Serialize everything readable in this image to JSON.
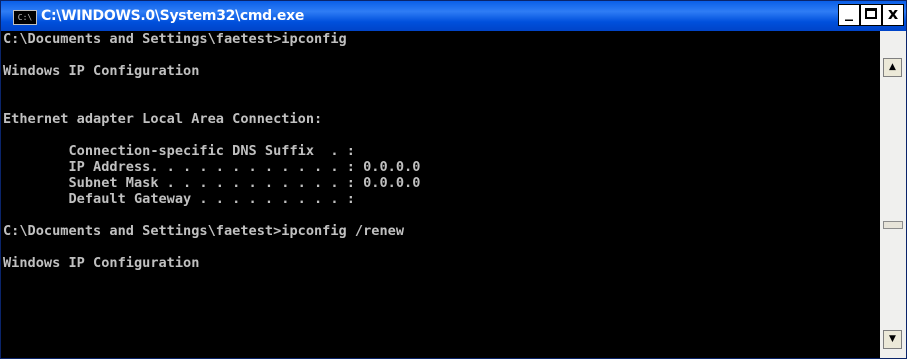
{
  "window": {
    "title": "C:\\WINDOWS.0\\System32\\cmd.exe",
    "icon_label": "C:\\",
    "controls": {
      "minimize": "_",
      "maximize": "",
      "close": "x"
    }
  },
  "console": {
    "lines": [
      "C:\\Documents and Settings\\faetest>ipconfig",
      "",
      "Windows IP Configuration",
      "",
      "",
      "Ethernet adapter Local Area Connection:",
      "",
      "        Connection-specific DNS Suffix  . :",
      "        IP Address. . . . . . . . . . . . : 0.0.0.0",
      "        Subnet Mask . . . . . . . . . . . : 0.0.0.0",
      "        Default Gateway . . . . . . . . . :",
      "",
      "C:\\Documents and Settings\\faetest>ipconfig /renew",
      "",
      "Windows IP Configuration"
    ]
  },
  "scrollbar": {
    "up_icon": "up-arrow-icon",
    "down_icon": "down-arrow-icon"
  }
}
